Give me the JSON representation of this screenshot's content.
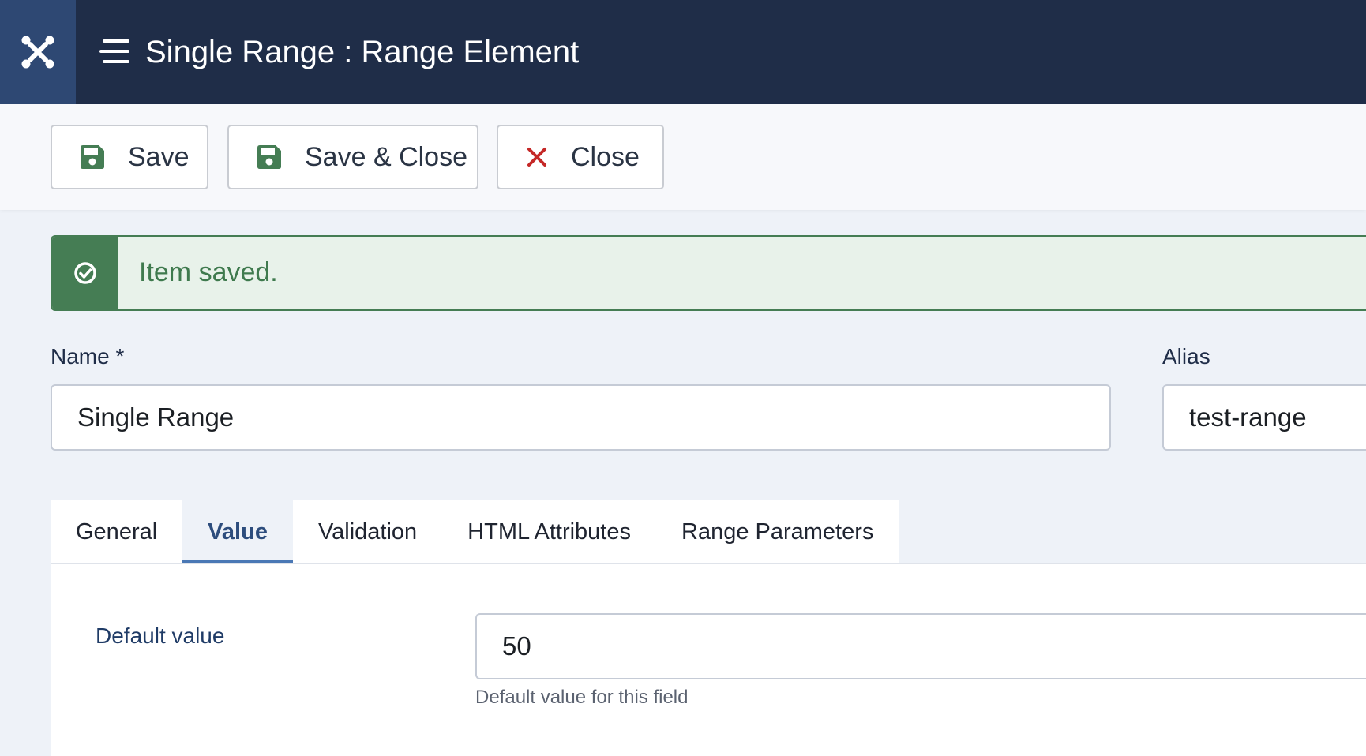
{
  "header": {
    "title": "Single Range : Range Element",
    "bg_color": "#1f2d48",
    "logo_icon": "joomla-logo-icon",
    "menu_icon": "hamburger-menu-icon"
  },
  "toolbar": {
    "save_label": "Save",
    "save_close_label": "Save & Close",
    "close_label": "Close",
    "save_icon": "floppy-disk-icon",
    "close_icon": "x-icon",
    "save_icon_color": "#457d54",
    "close_icon_color": "#c52827"
  },
  "alert": {
    "message": "Item saved.",
    "icon": "check-circle-icon",
    "color": "#457d54"
  },
  "form": {
    "name_label": "Name *",
    "name_value": "Single Range",
    "alias_label": "Alias",
    "alias_value": "test-range"
  },
  "tabs": [
    {
      "label": "General",
      "active": false
    },
    {
      "label": "Value",
      "active": true
    },
    {
      "label": "Validation",
      "active": false
    },
    {
      "label": "HTML Attributes",
      "active": false
    },
    {
      "label": "Range Parameters",
      "active": false
    }
  ],
  "value_tab": {
    "default_value_label": "Default value",
    "default_value": "50",
    "default_value_help": "Default value for this field"
  }
}
